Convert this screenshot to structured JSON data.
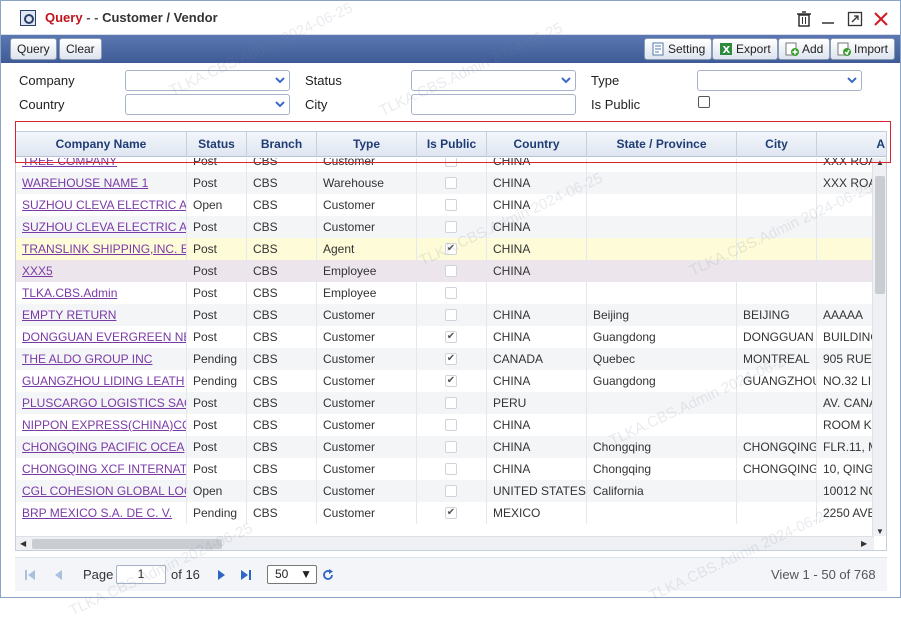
{
  "window": {
    "title_main": "Query",
    "title_sep": " - - ",
    "title_sub": "Customer / Vendor"
  },
  "toolbar": {
    "query_label": "Query",
    "clear_label": "Clear",
    "setting_label": "Setting",
    "export_label": "Export",
    "add_label": "Add",
    "import_label": "Import"
  },
  "form": {
    "company_label": "Company",
    "country_label": "Country",
    "status_label": "Status",
    "city_label": "City",
    "type_label": "Type",
    "is_public_label": "Is Public",
    "company_value": "",
    "country_value": "",
    "status_value": "",
    "city_value": "",
    "type_value": "",
    "is_public_checked": false
  },
  "grid": {
    "columns": [
      "Company Name",
      "Status",
      "Branch",
      "Type",
      "Is Public",
      "Country",
      "State / Province",
      "City",
      "A"
    ],
    "rows": [
      {
        "company": "TREE COMPANY",
        "status": "Post",
        "branch": "CBS",
        "type": "Customer",
        "is_public": false,
        "country": "CHINA",
        "state": "",
        "city": "",
        "address": "XXX ROA"
      },
      {
        "company": "WAREHOUSE NAME 1",
        "status": "Post",
        "branch": "CBS",
        "type": "Warehouse",
        "is_public": false,
        "country": "CHINA",
        "state": "",
        "city": "",
        "address": "XXX ROA"
      },
      {
        "company": "SUZHOU CLEVA ELECTRIC A",
        "status": "Open",
        "branch": "CBS",
        "type": "Customer",
        "is_public": false,
        "country": "CHINA",
        "state": "",
        "city": "",
        "address": ""
      },
      {
        "company": "SUZHOU CLEVA ELECTRIC A",
        "status": "Post",
        "branch": "CBS",
        "type": "Customer",
        "is_public": false,
        "country": "CHINA",
        "state": "",
        "city": "",
        "address": ""
      },
      {
        "company": "TRANSLINK SHIPPING,INC. E",
        "status": "Post",
        "branch": "CBS",
        "type": "Agent",
        "is_public": true,
        "country": "CHINA",
        "state": "",
        "city": "",
        "address": ""
      },
      {
        "company": "XXX5",
        "status": "Post",
        "branch": "CBS",
        "type": "Employee",
        "is_public": false,
        "country": "CHINA",
        "state": "",
        "city": "",
        "address": ""
      },
      {
        "company": "TLKA.CBS.Admin",
        "status": "Post",
        "branch": "CBS",
        "type": "Employee",
        "is_public": false,
        "country": "",
        "state": "",
        "city": "",
        "address": ""
      },
      {
        "company": "EMPTY RETURN",
        "status": "Post",
        "branch": "CBS",
        "type": "Customer",
        "is_public": false,
        "country": "CHINA",
        "state": "Beijing",
        "city": "BEIJING",
        "address": "AAAAA"
      },
      {
        "company": "DONGGUAN EVERGREEN NE",
        "status": "Post",
        "branch": "CBS",
        "type": "Customer",
        "is_public": true,
        "country": "CHINA",
        "state": "Guangdong",
        "city": "DONGGUAN",
        "address": "BUILDING"
      },
      {
        "company": "THE ALDO GROUP INC",
        "status": "Pending",
        "branch": "CBS",
        "type": "Customer",
        "is_public": true,
        "country": "CANADA",
        "state": "Quebec",
        "city": "MONTREAL",
        "address": "905 RUE"
      },
      {
        "company": "GUANGZHOU LIDING LEATH",
        "status": "Pending",
        "branch": "CBS",
        "type": "Customer",
        "is_public": true,
        "country": "CHINA",
        "state": "Guangdong",
        "city": "GUANGZHOU",
        "address": "NO.32 LI"
      },
      {
        "company": "PLUSCARGO LOGISTICS SAC",
        "status": "Post",
        "branch": "CBS",
        "type": "Customer",
        "is_public": false,
        "country": "PERU",
        "state": "",
        "city": "",
        "address": "AV. CANA"
      },
      {
        "company": "NIPPON EXPRESS(CHINA)CO",
        "status": "Post",
        "branch": "CBS",
        "type": "Customer",
        "is_public": false,
        "country": "CHINA",
        "state": "",
        "city": "",
        "address": "ROOM K"
      },
      {
        "company": "CHONGQING PACIFIC OCEA",
        "status": "Post",
        "branch": "CBS",
        "type": "Customer",
        "is_public": false,
        "country": "CHINA",
        "state": "Chongqing",
        "city": "CHONGQING",
        "address": "FLR.11, M"
      },
      {
        "company": "CHONGQING XCF INTERNAT",
        "status": "Post",
        "branch": "CBS",
        "type": "Customer",
        "is_public": false,
        "country": "CHINA",
        "state": "Chongqing",
        "city": "CHONGQING",
        "address": "10, QING"
      },
      {
        "company": "CGL COHESION GLOBAL LOC",
        "status": "Open",
        "branch": "CBS",
        "type": "Customer",
        "is_public": false,
        "country": "UNITED STATES",
        "state": "California",
        "city": "",
        "address": "10012 NO"
      },
      {
        "company": "BRP MEXICO S.A. DE C. V.",
        "status": "Pending",
        "branch": "CBS",
        "type": "Customer",
        "is_public": true,
        "country": "MEXICO",
        "state": "",
        "city": "",
        "address": "2250 AVE"
      }
    ]
  },
  "pager": {
    "page_label": "Page",
    "page_value": "1",
    "of_label": "of 16",
    "page_size": "50",
    "view_text": "View 1 - 50 of 768"
  },
  "watermark_text": "TLKA.CBS.Admin 2024-06-25",
  "colors": {
    "title_red": "#c0141c",
    "toolbar_blue": "#4a67a3",
    "link_purple": "#7a3aa6",
    "highlight_row": "#fdfbd8",
    "outline_red": "#d9232d"
  }
}
